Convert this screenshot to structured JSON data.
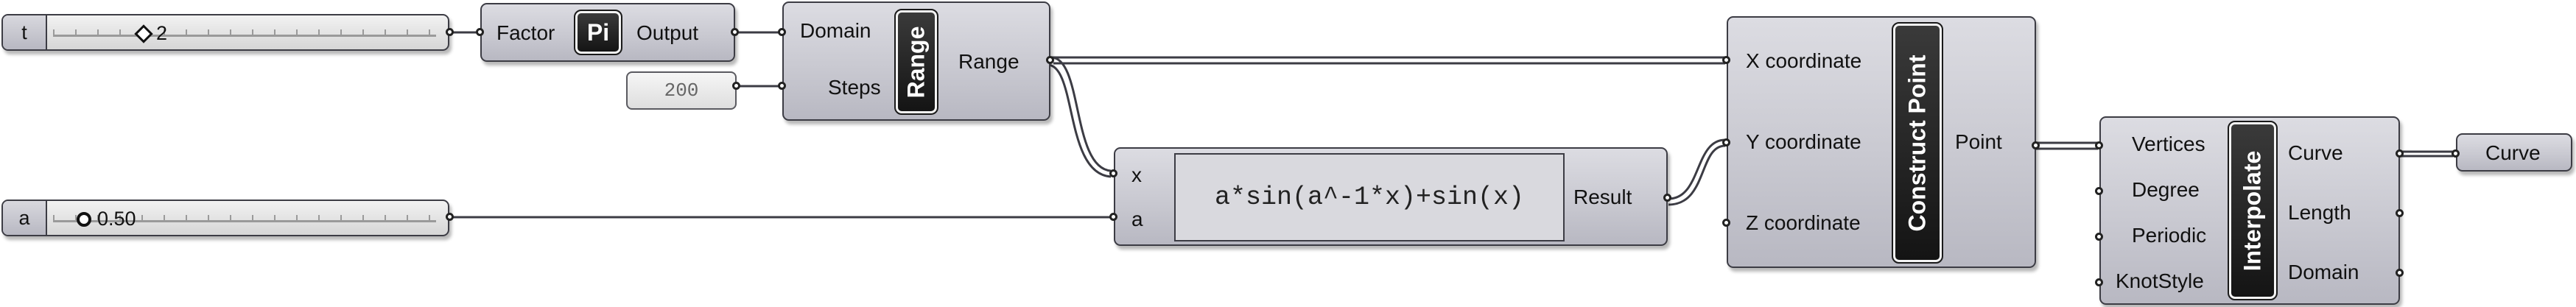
{
  "slider_t": {
    "name": "t",
    "value": "2"
  },
  "slider_a": {
    "name": "a",
    "value": "0.50"
  },
  "pi": {
    "input": "Factor",
    "badge": "Pi",
    "output": "Output"
  },
  "range": {
    "inputs": [
      "Domain",
      "Steps"
    ],
    "badge": "Range",
    "output": "Range"
  },
  "steps_panel": {
    "value": "200"
  },
  "expression": {
    "inputs": [
      "x",
      "a"
    ],
    "formula": "a*sin(a^-1*x)+sin(x)",
    "output": "Result"
  },
  "construct_point": {
    "inputs": [
      "X coordinate",
      "Y coordinate",
      "Z coordinate"
    ],
    "badge": "Construct Point",
    "output": "Point"
  },
  "interpolate": {
    "inputs": [
      "Vertices",
      "Degree",
      "Periodic",
      "KnotStyle"
    ],
    "badge": "Interpolate",
    "outputs": [
      "Curve",
      "Length",
      "Domain"
    ]
  },
  "curve_param": {
    "label": "Curve"
  },
  "colors": {
    "wire": "#3c3c44",
    "component_fill": "#c9c9d1",
    "badge_fill": "#1e1e1e"
  }
}
